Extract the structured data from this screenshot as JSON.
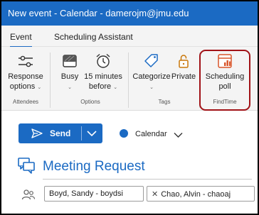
{
  "window": {
    "title": "New event - Calendar - damerojm@jmu.edu"
  },
  "tabs": {
    "event": "Event",
    "scheduling_assistant": "Scheduling Assistant"
  },
  "ribbon": {
    "response_options": {
      "line1": "Response",
      "line2": "options"
    },
    "busy": "Busy",
    "reminder": {
      "line1": "15 minutes",
      "line2": "before"
    },
    "categorize": "Categorize",
    "private": "Private",
    "scheduling_poll": {
      "line1": "Scheduling",
      "line2": "poll"
    },
    "groups": {
      "attendees": "Attendees",
      "options": "Options",
      "tags": "Tags",
      "findtime": "FindTime"
    }
  },
  "compose": {
    "send_label": "Send",
    "calendar_label": "Calendar",
    "title": "Meeting Request",
    "attendees": [
      "Boyd, Sandy - boydsi",
      "Chao, Alvin - chaoaj"
    ]
  },
  "colors": {
    "accent": "#1b6ac3",
    "highlight": "#a11217",
    "poll_icon": "#d8552a"
  }
}
